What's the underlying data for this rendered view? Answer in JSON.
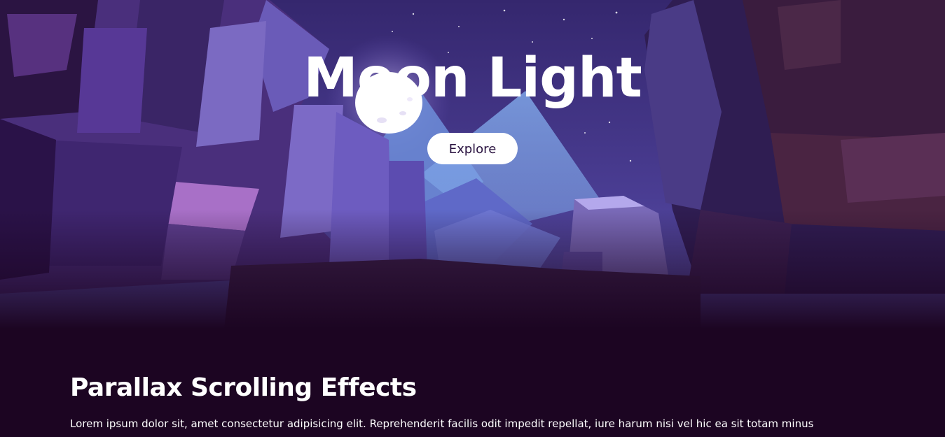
{
  "hero": {
    "title": "Moon Light",
    "explore_label": "Explore"
  },
  "section": {
    "heading": "Parallax Scrolling Effects",
    "paragraph": "Lorem ipsum dolor sit, amet consectetur adipisicing elit. Reprehenderit facilis odit impedit repellat, iure harum nisi vel hic ea sit totam minus"
  },
  "colors": {
    "page_background": "#1c0522",
    "sky": "#3b2a78",
    "button_background": "#ffffff",
    "button_text": "#2a1340",
    "text": "#ffffff"
  }
}
